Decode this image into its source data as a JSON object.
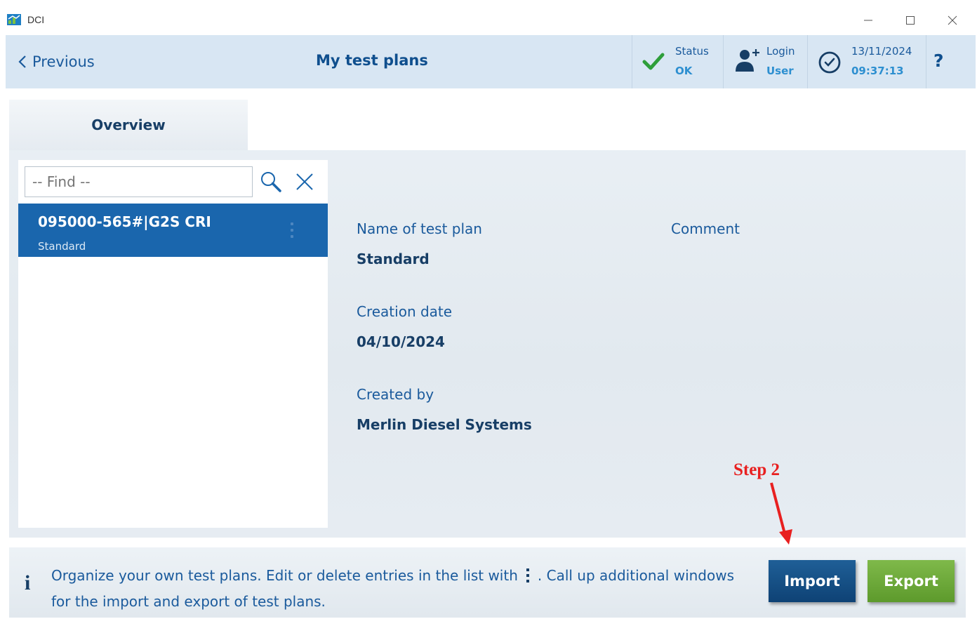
{
  "window": {
    "title": "DCI",
    "icons": [
      "app-logo-icon",
      "minimize-icon",
      "maximize-icon",
      "close-icon"
    ]
  },
  "header": {
    "previous_label": "Previous",
    "page_title": "My test plans",
    "status": {
      "label": "Status",
      "value": "OK",
      "icon": "checkmark-icon"
    },
    "login": {
      "label": "Login",
      "value": "User",
      "icon": "add-user-icon"
    },
    "datetime": {
      "date": "13/11/2024",
      "time": "09:37:13",
      "icon": "clock-icon"
    },
    "help_label": "?"
  },
  "tabs": [
    {
      "label": "Overview",
      "active": true
    }
  ],
  "search": {
    "placeholder": "-- Find --",
    "value": ""
  },
  "list": {
    "items": [
      {
        "title": "095000-565#|G2S CRI",
        "subtitle": "Standard",
        "selected": true
      }
    ]
  },
  "details": {
    "name_label": "Name of test plan",
    "name_value": "Standard",
    "comment_label": "Comment",
    "creation_label": "Creation date",
    "creation_value": "04/10/2024",
    "created_by_label": "Created by",
    "created_by_value": "Merlin Diesel Systems"
  },
  "annotation": {
    "text": "Step 2",
    "color": "#e82020"
  },
  "footer": {
    "info_icon": "i",
    "text_before": "Organize your own test plans. Edit or delete entries in the list with",
    "text_after": ". Call up additional windows for the import and export of test plans.",
    "import_label": "Import",
    "export_label": "Export"
  },
  "colors": {
    "primary_blue": "#1a66ad",
    "header_bg": "#d8e6f3",
    "status_green": "#2e9e3a",
    "export_green": "#6eaa3a",
    "import_blue": "#15518a"
  }
}
